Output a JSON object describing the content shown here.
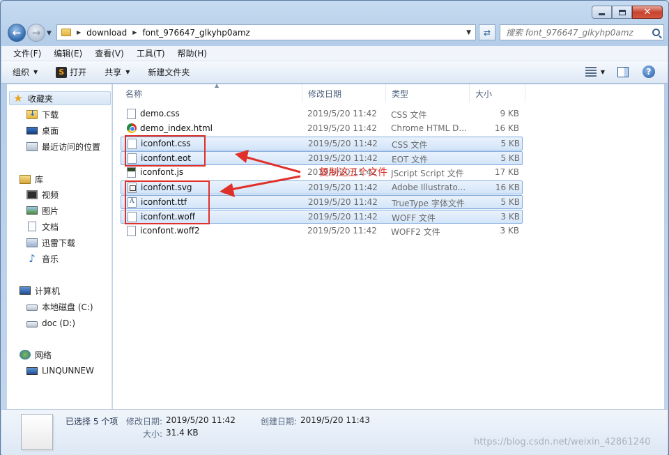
{
  "window": {
    "caption": {
      "minimize": "minimize",
      "maximize": "maximize",
      "close": "✕"
    }
  },
  "address": {
    "crumbs": [
      "download",
      "font_976647_glkyhp0amz"
    ],
    "search_placeholder": "搜索 font_976647_glkyhp0amz"
  },
  "menubar": [
    "文件(F)",
    "编辑(E)",
    "查看(V)",
    "工具(T)",
    "帮助(H)"
  ],
  "toolbar": {
    "organize": "组织",
    "open": "打开",
    "share": "共享",
    "new_folder": "新建文件夹",
    "help": "?"
  },
  "nav": {
    "favorites": "收藏夹",
    "downloads": "下载",
    "desktop": "桌面",
    "recent": "最近访问的位置",
    "libraries": "库",
    "videos": "视频",
    "pictures": "图片",
    "documents": "文档",
    "thunder": "迅雷下载",
    "music": "音乐",
    "computer": "计算机",
    "drive_c": "本地磁盘 (C:)",
    "drive_d": "doc (D:)",
    "network": "网络",
    "network_pc": "LINQUNNEW"
  },
  "columns": {
    "name": "名称",
    "date": "修改日期",
    "type": "类型",
    "size": "大小"
  },
  "files": [
    {
      "name": "demo.css",
      "date": "2019/5/20 11:42",
      "type": "CSS 文件",
      "size": "9 KB",
      "icon": "css-file-icon",
      "selected": false
    },
    {
      "name": "demo_index.html",
      "date": "2019/5/20 11:42",
      "type": "Chrome HTML D...",
      "size": "16 KB",
      "icon": "chrome-icon",
      "selected": false
    },
    {
      "name": "iconfont.css",
      "date": "2019/5/20 11:42",
      "type": "CSS 文件",
      "size": "5 KB",
      "icon": "css-file-icon",
      "selected": true
    },
    {
      "name": "iconfont.eot",
      "date": "2019/5/20 11:42",
      "type": "EOT 文件",
      "size": "5 KB",
      "icon": "file-icon",
      "selected": true
    },
    {
      "name": "iconfont.js",
      "date": "2019/5/20 11:42",
      "type": "JScript Script 文件",
      "size": "17 KB",
      "icon": "js-file-icon",
      "selected": false
    },
    {
      "name": "iconfont.svg",
      "date": "2019/5/20 11:42",
      "type": "Adobe Illustrato...",
      "size": "16 KB",
      "icon": "svg-file-icon",
      "selected": true
    },
    {
      "name": "iconfont.ttf",
      "date": "2019/5/20 11:42",
      "type": "TrueType 字体文件",
      "size": "5 KB",
      "icon": "font-file-icon",
      "selected": true
    },
    {
      "name": "iconfont.woff",
      "date": "2019/5/20 11:42",
      "type": "WOFF 文件",
      "size": "3 KB",
      "icon": "file-icon",
      "selected": true
    },
    {
      "name": "iconfont.woff2",
      "date": "2019/5/20 11:42",
      "type": "WOFF2 文件",
      "size": "3 KB",
      "icon": "file-icon",
      "selected": false
    }
  ],
  "annotation": {
    "text": "复制这五个文件",
    "color": "#e0302a"
  },
  "details": {
    "selected_count": "已选择 5 个项",
    "modified_label": "修改日期:",
    "modified_value": "2019/5/20 11:42",
    "created_label": "创建日期:",
    "created_value": "2019/5/20 11:43",
    "size_label": "大小:",
    "size_value": "31.4 KB"
  },
  "watermark": "https://blog.csdn.net/weixin_42861240"
}
